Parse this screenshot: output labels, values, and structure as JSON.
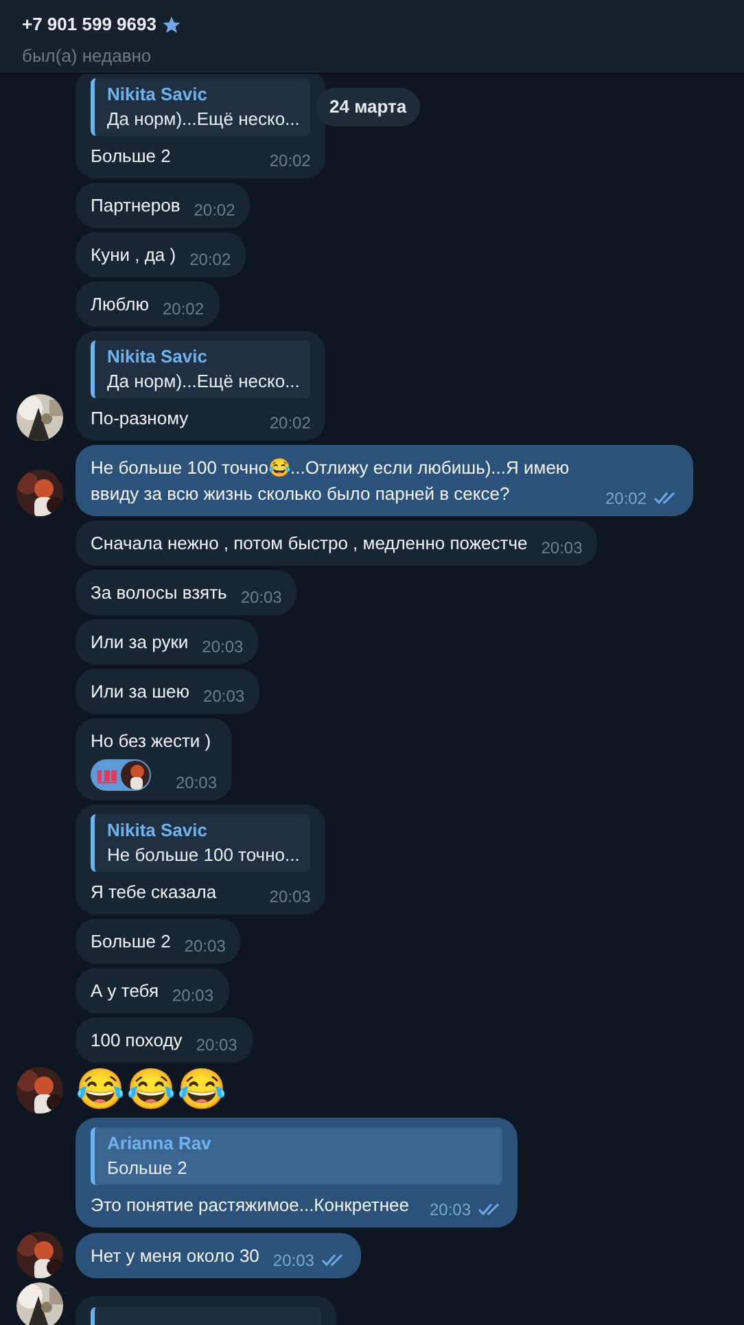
{
  "header": {
    "title": "+7 901 599 9693",
    "starred": true,
    "status": "был(а) недавно"
  },
  "date_badge": "24 марта",
  "messages": [
    {
      "kind": "in",
      "reply": {
        "name": "Nikita Savic",
        "text": "Да норм)...Ещё неско..."
      },
      "text": "Больше 2",
      "time": "20:02",
      "avatar": false
    },
    {
      "kind": "in",
      "text": "Партнеров",
      "time": "20:02",
      "avatar": false
    },
    {
      "kind": "in",
      "text": "Куни , да )",
      "time": "20:02",
      "avatar": false
    },
    {
      "kind": "in",
      "text": "Люблю",
      "time": "20:02",
      "avatar": false
    },
    {
      "kind": "in",
      "reply": {
        "name": "Nikita Savic",
        "text": "Да норм)...Ещё неско..."
      },
      "text": "По-разному",
      "time": "20:02",
      "avatar": true
    },
    {
      "kind": "out",
      "text": "Не больше 100 точно😂...Отлижу если любишь)...Я имею ввиду за всю жизнь сколько было парней в сексе?",
      "time": "20:02",
      "read": true,
      "avatar": true
    },
    {
      "kind": "in",
      "text": "Сначала нежно , потом быстро , медленно пожестче",
      "time": "20:03",
      "avatar": false
    },
    {
      "kind": "in",
      "text": "За волосы взять",
      "time": "20:03",
      "avatar": false
    },
    {
      "kind": "in",
      "text": "Или за руки",
      "time": "20:03",
      "avatar": false
    },
    {
      "kind": "in",
      "text": "Или за шею",
      "time": "20:03",
      "avatar": false
    },
    {
      "kind": "in",
      "text": "Но без жести )",
      "time": "20:03",
      "reaction": true,
      "avatar": false
    },
    {
      "kind": "in",
      "reply": {
        "name": "Nikita Savic",
        "text": "Не больше 100 точно..."
      },
      "text": "Я тебе сказала",
      "time": "20:03",
      "avatar": false
    },
    {
      "kind": "in",
      "text": "Больше 2",
      "time": "20:03",
      "avatar": false
    },
    {
      "kind": "in",
      "text": "А у тебя",
      "time": "20:03",
      "avatar": false
    },
    {
      "kind": "in",
      "text": "100 походу",
      "time": "20:03",
      "avatar": false
    },
    {
      "kind": "emoji",
      "text": "😂😂😂",
      "avatar": true
    },
    {
      "kind": "out",
      "reply": {
        "name": "Arianna Rav",
        "text": "Больше 2"
      },
      "text": "Это понятие растяжимое...Конкретнее",
      "time": "20:03",
      "read": true,
      "avatar": false
    },
    {
      "kind": "out",
      "text": "Нет у меня около 30",
      "time": "20:03",
      "read": true,
      "avatar": true
    },
    {
      "kind": "partial",
      "avatar": true
    }
  ]
}
